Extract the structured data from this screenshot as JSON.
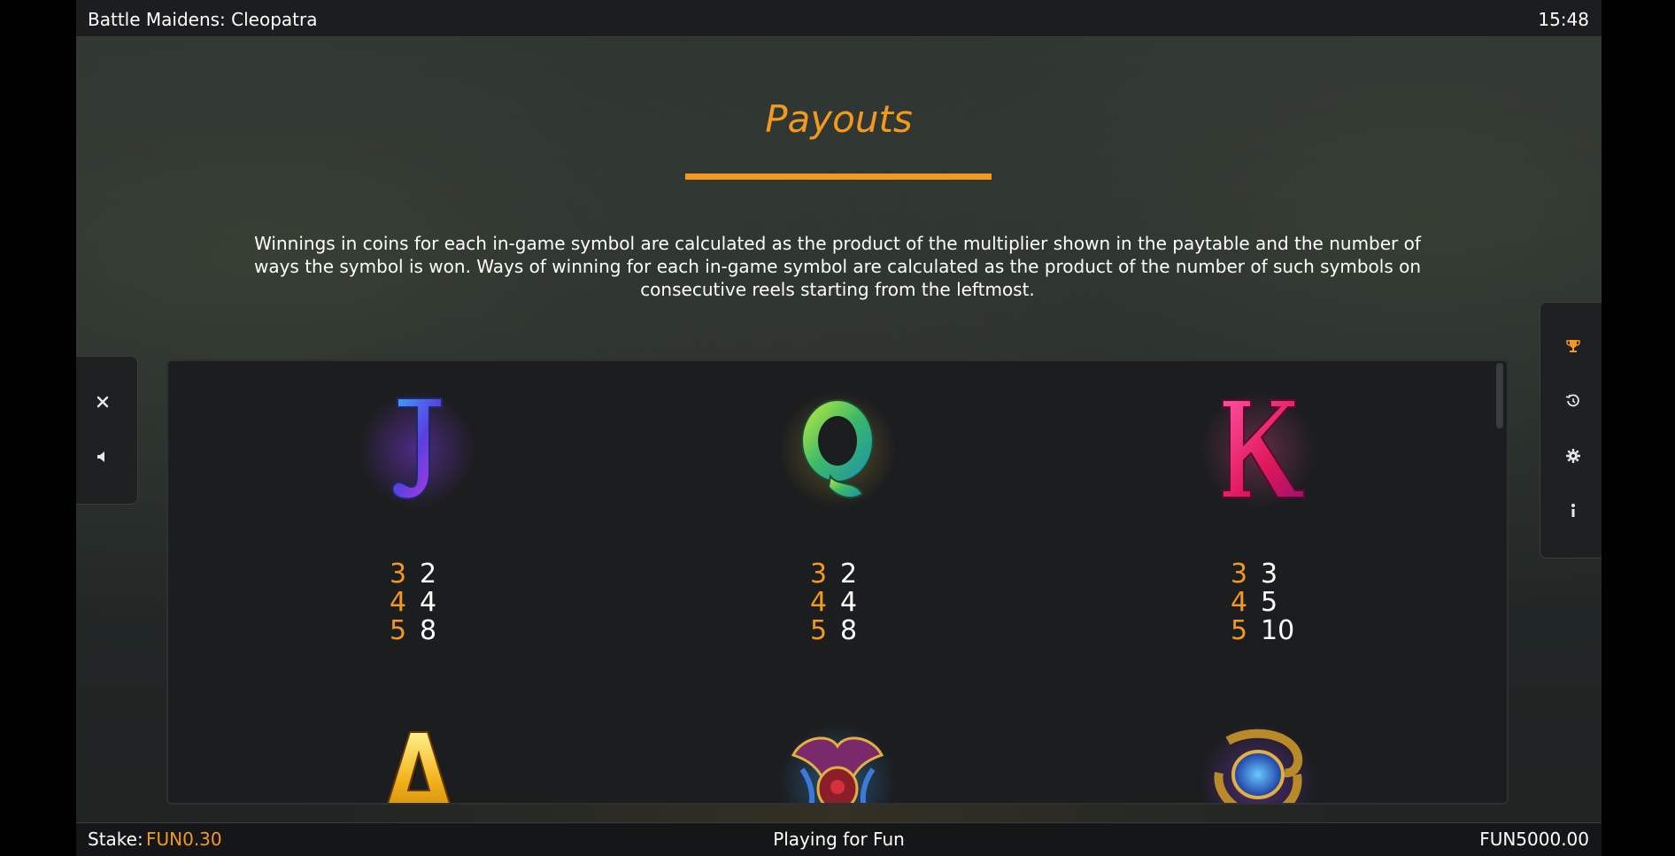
{
  "header": {
    "title": "Battle Maidens: Cleopatra",
    "time": "15:48"
  },
  "page": {
    "title": "Payouts",
    "description": "Winnings in coins for each in-game symbol are calculated as the product of the multiplier shown in the paytable and the number of ways the symbol is won. Ways of winning for each in-game symbol are calculated as the product of the number of such symbols on consecutive reels starting from the leftmost."
  },
  "left_menu": {
    "icons": [
      "close-icon",
      "speaker-icon"
    ]
  },
  "right_menu": {
    "icons": [
      "trophy-icon",
      "history-icon",
      "gear-icon",
      "info-icon"
    ],
    "active": "trophy-icon"
  },
  "paytable": {
    "symbols": [
      {
        "name": "J",
        "pays": [
          {
            "count": "3",
            "value": "2"
          },
          {
            "count": "4",
            "value": "4"
          },
          {
            "count": "5",
            "value": "8"
          }
        ]
      },
      {
        "name": "Q",
        "pays": [
          {
            "count": "3",
            "value": "2"
          },
          {
            "count": "4",
            "value": "4"
          },
          {
            "count": "5",
            "value": "8"
          }
        ]
      },
      {
        "name": "K",
        "pays": [
          {
            "count": "3",
            "value": "3"
          },
          {
            "count": "4",
            "value": "5"
          },
          {
            "count": "5",
            "value": "10"
          }
        ]
      },
      {
        "name": "A"
      },
      {
        "name": "scarab"
      },
      {
        "name": "amulet"
      }
    ]
  },
  "footer": {
    "stake_label": "Stake:",
    "stake_value": "FUN0.30",
    "mode": "Playing for Fun",
    "balance": "FUN5000.00"
  },
  "colors": {
    "accent": "#f39a1e",
    "panel": "#1c1d1f",
    "bar": "#1b1d1e"
  }
}
